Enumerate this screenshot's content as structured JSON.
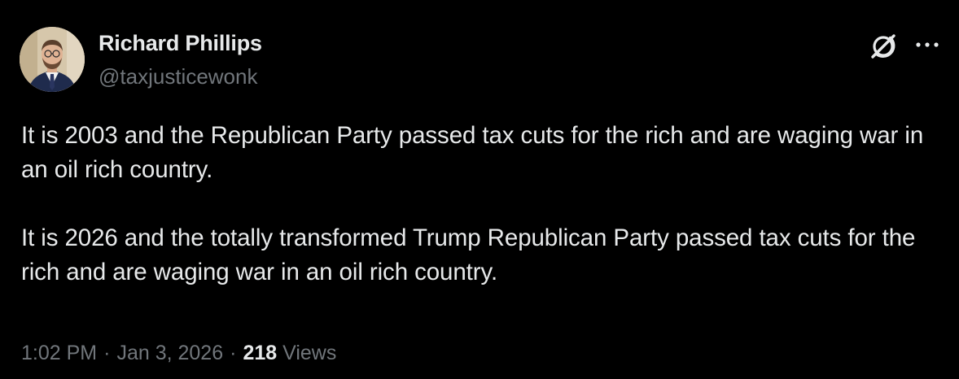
{
  "author": {
    "name": "Richard Phillips",
    "handle": "@taxjusticewonk"
  },
  "icons": {
    "grok": "grok-icon",
    "more": "more-options-icon",
    "avatar": "profile-photo"
  },
  "tweet": {
    "paragraphs": [
      "It is 2003 and the Republican Party passed tax cuts for the rich and are waging war in an oil rich country.",
      "It is 2026 and the totally transformed Trump Republican Party passed tax cuts for the rich and are waging war in an oil rich country."
    ]
  },
  "meta": {
    "time": "1:02 PM",
    "separator": "·",
    "date": "Jan 3, 2026",
    "views_count": "218",
    "views_label": "Views"
  },
  "colors": {
    "background": "#000000",
    "primary_text": "#e7e9ea",
    "secondary_text": "#71767b"
  }
}
